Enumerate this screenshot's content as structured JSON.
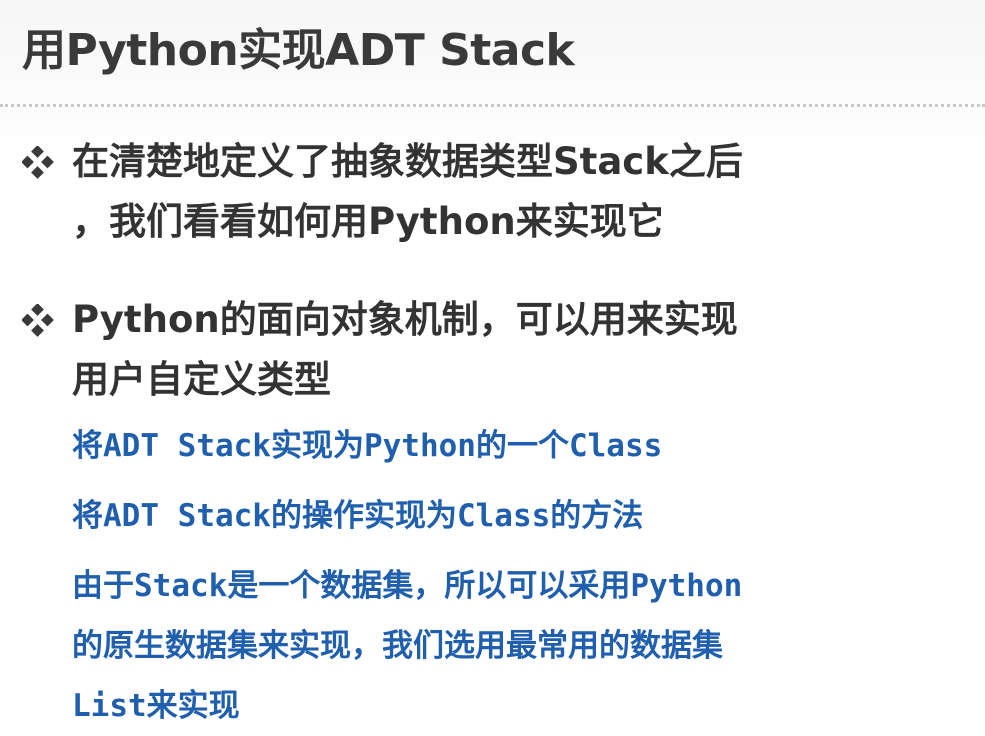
{
  "title": "用Python实现ADT Stack",
  "bullets": [
    {
      "icon": "diamond-bullet-icon",
      "text": "在清楚地定义了抽象数据类型Stack之后\n，我们看看如何用Python来实现它"
    },
    {
      "icon": "diamond-bullet-icon",
      "text": "Python的面向对象机制，可以用来实现\n用户自定义类型"
    }
  ],
  "sub_items": [
    "将ADT Stack实现为Python的一个Class",
    "将ADT Stack的操作实现为Class的方法",
    "由于Stack是一个数据集，所以可以采用Python\n的原生数据集来实现，我们选用最常用的数据集\nList来实现"
  ],
  "colors": {
    "title": "#3a3a3a",
    "bullet_text": "#333333",
    "sub_text": "#1f5fae",
    "rule": "#c9c9c9"
  }
}
